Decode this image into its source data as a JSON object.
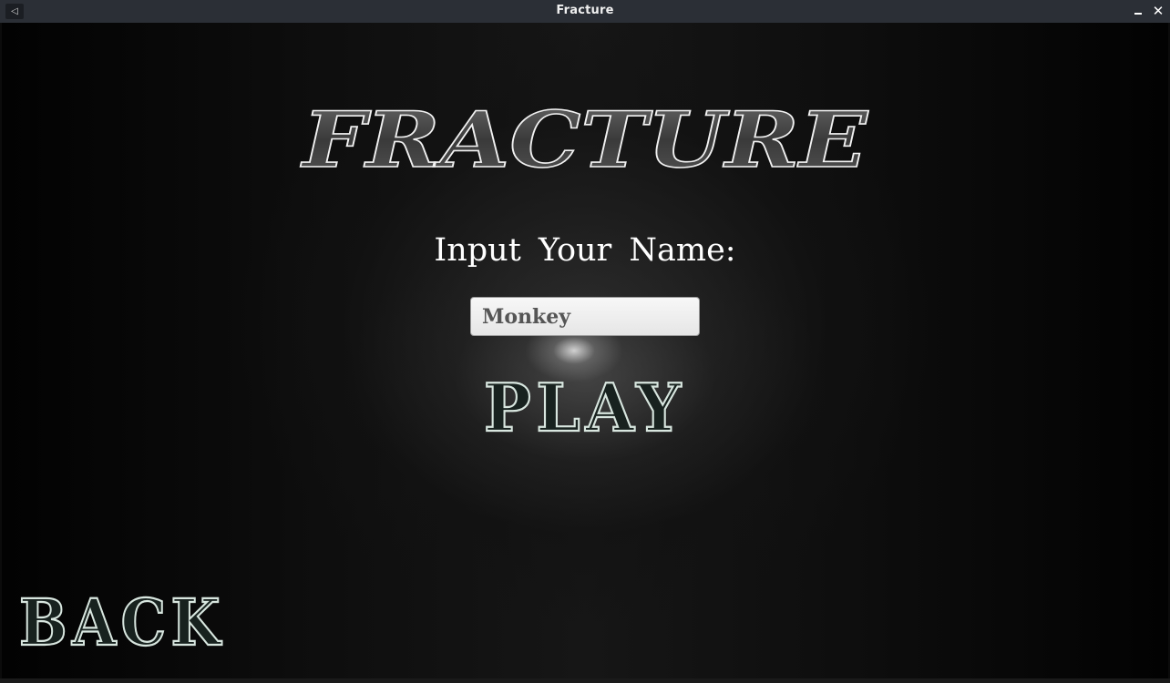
{
  "window": {
    "title": "Fracture",
    "app_icon": "back-arrow-icon",
    "minimize_icon": "minimize-icon",
    "close_icon": "close-icon",
    "close_glyph": "✕"
  },
  "menu": {
    "logo_text": "FRACTURE",
    "prompt_label": "Input Your Name:",
    "name_input_value": "Monkey",
    "play_label": "PLAY",
    "back_label": "BACK"
  },
  "colors": {
    "titlebar_bg": "#2b2f36",
    "button_outline": "#d8e6df",
    "button_fill": "#18221f",
    "logo_outline": "#f2f2f2",
    "logo_fill": "#3c3c3c"
  }
}
